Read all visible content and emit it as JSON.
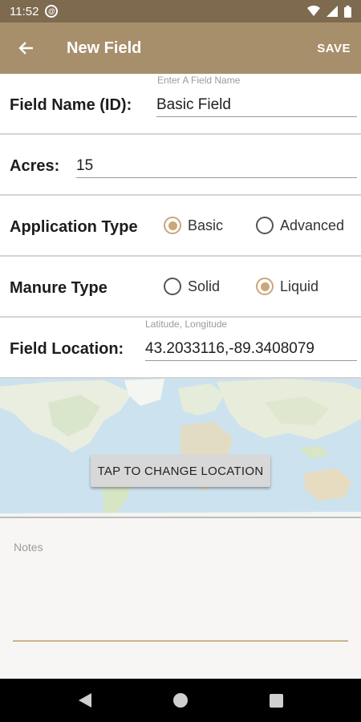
{
  "status": {
    "time": "11:52",
    "notification_badge": "@"
  },
  "app_bar": {
    "title": "New Field",
    "save_label": "SAVE"
  },
  "form": {
    "field_name": {
      "label": "Field Name (ID):",
      "hint": "Enter A Field Name",
      "value": "Basic Field"
    },
    "acres": {
      "label": "Acres:",
      "value": "15"
    },
    "application_type": {
      "label": "Application Type",
      "options": [
        {
          "label": "Basic",
          "selected": true
        },
        {
          "label": "Advanced",
          "selected": false
        }
      ]
    },
    "manure_type": {
      "label": "Manure Type",
      "options": [
        {
          "label": "Solid",
          "selected": false
        },
        {
          "label": "Liquid",
          "selected": true
        }
      ]
    },
    "field_location": {
      "label": "Field Location:",
      "hint": "Latitude, Longitude",
      "value": "43.2033116,-89.3408079"
    }
  },
  "map": {
    "button_label": "TAP TO CHANGE LOCATION"
  },
  "notes": {
    "placeholder": "Notes"
  },
  "colors": {
    "app_bar": "#a88f6c",
    "status_bar": "#7d6a4f",
    "accent": "#c9a779"
  }
}
